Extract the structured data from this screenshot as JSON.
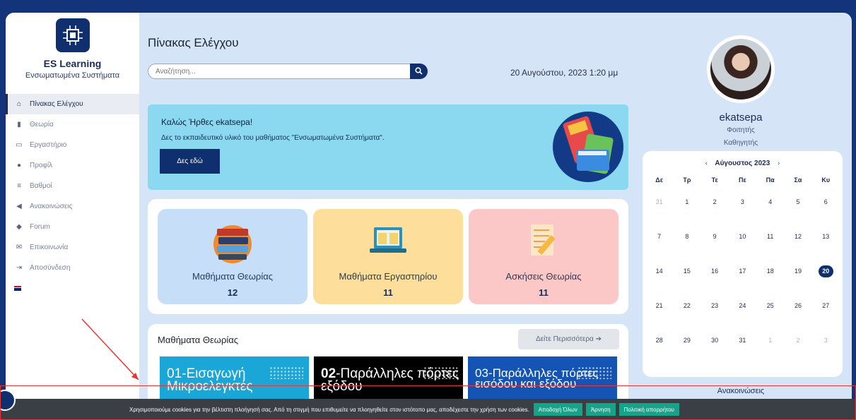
{
  "brand": {
    "name": "ES Learning",
    "subtitle": "Ενσωματωμένα Συστήματα"
  },
  "sidebar": {
    "items": [
      {
        "label": "Πίνακας Ελέγχου",
        "icon": "home-icon",
        "glyph": "⌂"
      },
      {
        "label": "Θεωρία",
        "icon": "book-icon",
        "glyph": "▮"
      },
      {
        "label": "Εργαστήριο",
        "icon": "monitor-icon",
        "glyph": "▭"
      },
      {
        "label": "Προφίλ",
        "icon": "user-icon",
        "glyph": "●"
      },
      {
        "label": "Βαθμοί",
        "icon": "grades-icon",
        "glyph": "≡"
      },
      {
        "label": "Ανακοινώσεις",
        "icon": "megaphone-icon",
        "glyph": "◀"
      },
      {
        "label": "Forum",
        "icon": "chat-icon",
        "glyph": "◆"
      },
      {
        "label": "Επικοινωνία",
        "icon": "envelope-icon",
        "glyph": "✉"
      },
      {
        "label": "Αποσύνδεση",
        "icon": "logout-icon",
        "glyph": "⇥"
      }
    ],
    "language_flag": "uk-flag-icon"
  },
  "header": {
    "title": "Πίνακας Ελέγχου",
    "search_placeholder": "Αναζήτηση...",
    "datetime": "20 Αυγούστου, 2023 1:20 μμ"
  },
  "welcome": {
    "heading": "Καλώς Ήρθες ekatsepa!",
    "text": "Δες το εκπαιδευτικό υλικό του μαθήματος \"Ενσωματωμένα Συστήματα\".",
    "button": "Δες εδώ"
  },
  "stats": [
    {
      "label": "Μαθήματα Θεωρίας",
      "value": "12",
      "color": "#c6def8"
    },
    {
      "label": "Μαθήματα Εργαστηρίου",
      "value": "11",
      "color": "#fddf9b"
    },
    {
      "label": "Ασκήσεις Θεωρίας",
      "value": "11",
      "color": "#fbc7c7"
    }
  ],
  "courses": {
    "title": "Μαθήματα Θεωρίας",
    "more_button": "Δείτε Περισσότερα ➔",
    "cards": [
      {
        "num": "01",
        "text": "Εισαγωγή Μικροελεγκτές",
        "bg": "#1aa6d6"
      },
      {
        "num": "02",
        "text": "Παράλληλες πόρτες εξόδου",
        "bg": "#000000"
      },
      {
        "num": "03",
        "text": "Παράλληλες πόρτες εισόδου και εξόδου",
        "bg": "#1354b4"
      }
    ]
  },
  "profile": {
    "username": "ekatsepa",
    "role1": "Φοιτητής",
    "role2": "Καθηγητής"
  },
  "calendar": {
    "month": "Αύγουστος 2023",
    "weekdays": [
      "Δε",
      "Τρ",
      "Τε",
      "Πε",
      "Πα",
      "Σα",
      "Κυ"
    ],
    "weeks": [
      [
        "31",
        "1",
        "2",
        "3",
        "4",
        "5",
        "6"
      ],
      [
        "7",
        "8",
        "9",
        "10",
        "11",
        "12",
        "13"
      ],
      [
        "14",
        "15",
        "16",
        "17",
        "18",
        "19",
        "20"
      ],
      [
        "21",
        "22",
        "23",
        "24",
        "25",
        "26",
        "27"
      ],
      [
        "28",
        "29",
        "30",
        "31",
        "1",
        "2",
        "3"
      ]
    ],
    "today": "20"
  },
  "announcements_label": "Ανακοινώσεις",
  "cookie": {
    "text": "Χρησιμοποιούμε cookies για την βέλτιστη πλοήγησή σας. Από τη στιγμή που επιθυμείτε να πλοηγηθείτε στον ιστότοπο μας, αποδέχεστε την χρήση των cookies.",
    "accept": "Αποδοχή Όλων",
    "reject": "Άρνηση",
    "policy": "Πολιτική απορρήτου"
  },
  "colors": {
    "navy": "#0f2f6e",
    "accent_green": "#17a389",
    "background": "#d6e4f8",
    "outer": "#13337a"
  }
}
